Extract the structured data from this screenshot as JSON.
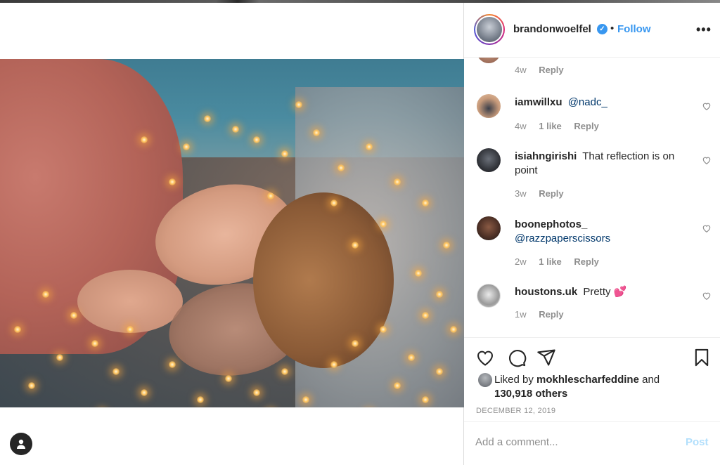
{
  "post": {
    "username": "brandonwoelfel",
    "verified_glyph": "✓",
    "separator": "•",
    "follow_label": "Follow",
    "more_label": "•••"
  },
  "comments": {
    "top_partial": {
      "time": "4w",
      "reply": "Reply"
    },
    "items": [
      {
        "user": "iamwillxu",
        "mention": "@nadc_",
        "text": "",
        "time": "4w",
        "likes": "1 like",
        "reply": "Reply"
      },
      {
        "user": "isiahngirishi",
        "mention": "",
        "text": "That reflection is on point",
        "time": "3w",
        "likes": "",
        "reply": "Reply"
      },
      {
        "user": "boonephotos_",
        "mention": "@razzpaperscissors",
        "text": "",
        "time": "2w",
        "likes": "1 like",
        "reply": "Reply"
      },
      {
        "user": "houstons.uk",
        "mention": "",
        "text": "Pretty 💕",
        "time": "1w",
        "likes": "",
        "reply": "Reply"
      }
    ]
  },
  "engagement": {
    "liked_prefix": "Liked by",
    "liked_user": "mokhlescharfeddine",
    "liked_and": "and",
    "liked_count": "130,918 others",
    "date": "DECEMBER 12, 2019"
  },
  "composer": {
    "placeholder": "Add a comment...",
    "post_label": "Post"
  },
  "colors": {
    "accent": "#3897f0",
    "post_disabled": "#b2dffc",
    "muted": "#8e8e8e"
  }
}
